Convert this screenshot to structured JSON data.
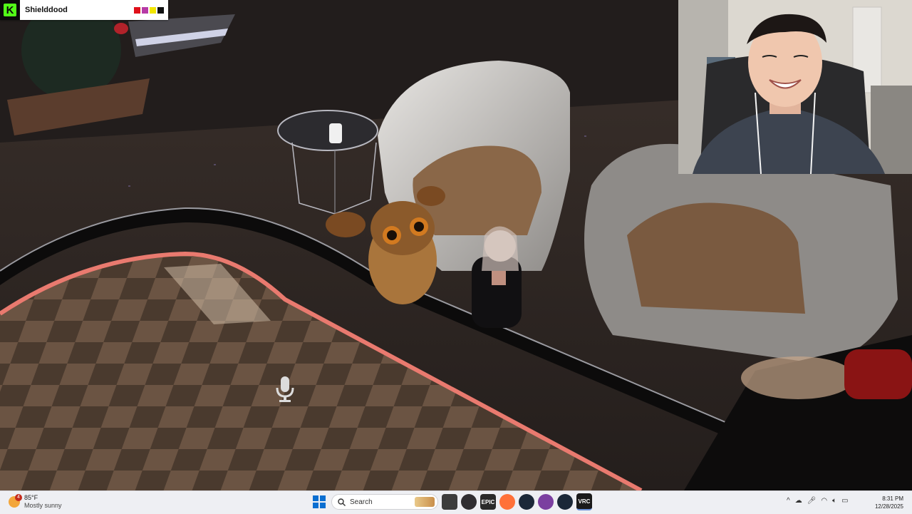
{
  "kick": {
    "channel_name": "Shielddood",
    "swatch_colors": [
      "#e0101a",
      "#b63aa6",
      "#f2e600",
      "#111111"
    ]
  },
  "scene": {
    "mic_icon": "microphone-icon"
  },
  "taskbar": {
    "weather": {
      "temp": "85°F",
      "condition": "Mostly sunny",
      "badge": "4"
    },
    "search_label": "Search",
    "apps": [
      {
        "name": "task-view",
        "label": ""
      },
      {
        "name": "obs",
        "label": ""
      },
      {
        "name": "epic-games",
        "label": "EPIC"
      },
      {
        "name": "firefox",
        "label": ""
      },
      {
        "name": "steam",
        "label": ""
      },
      {
        "name": "app-purple",
        "label": ""
      },
      {
        "name": "steam-2",
        "label": ""
      },
      {
        "name": "vrchat",
        "label": "VRC"
      }
    ],
    "tray_chevron": "^",
    "time": "8:31 PM",
    "date": "12/28/2025"
  }
}
